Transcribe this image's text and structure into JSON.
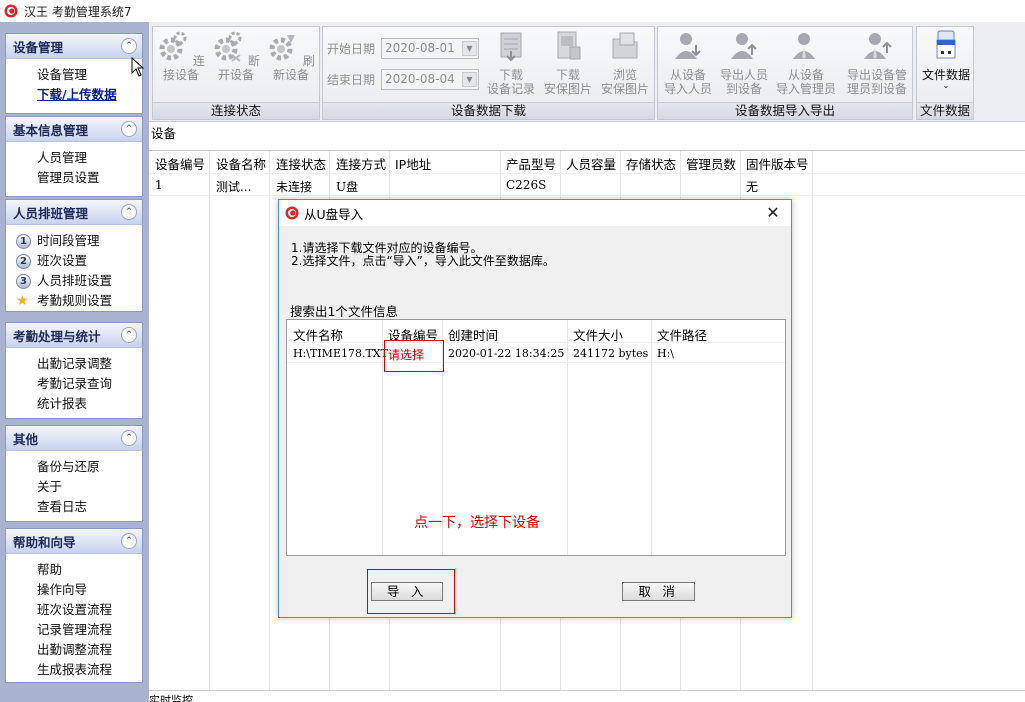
{
  "window": {
    "title": "汉王 考勤管理系统7"
  },
  "sidebar": {
    "panels": [
      {
        "title": "设备管理",
        "items": [
          "设备管理",
          "下载/上传数据"
        ]
      },
      {
        "title": "基本信息管理",
        "items": [
          "人员管理",
          "管理员设置"
        ]
      },
      {
        "title": "人员排班管理",
        "items": [
          "时间段管理",
          "班次设置",
          "人员排班设置",
          "考勤规则设置"
        ],
        "badges": [
          "1",
          "2",
          "3"
        ]
      },
      {
        "title": "考勤处理与统计",
        "items": [
          "出勤记录调整",
          "考勤记录查询",
          "统计报表"
        ]
      },
      {
        "title": "其他",
        "items": [
          "备份与还原",
          "关于",
          "查看日志"
        ]
      },
      {
        "title": "帮助和向导",
        "items": [
          "帮助",
          "操作向导",
          "班次设置流程",
          "记录管理流程",
          "出勤调整流程",
          "生成报表流程"
        ]
      }
    ]
  },
  "toolbar": {
    "connection": {
      "label": "连接状态",
      "connect": "连接设备",
      "disconnect": "断开设备",
      "refresh": "刷新设备"
    },
    "download": {
      "label": "设备数据下载",
      "start_label": "开始日期",
      "start_value": "2020-08-01",
      "end_label": "结束日期",
      "end_value": "2020-08-04",
      "btn1": [
        "下载",
        "设备记录"
      ],
      "btn2": [
        "下载",
        "安保图片"
      ],
      "btn3": [
        "浏览",
        "安保图片"
      ]
    },
    "io": {
      "label": "设备数据导入导出",
      "btn1": [
        "从设备",
        "导入人员"
      ],
      "btn2": [
        "导出人员",
        "到设备"
      ],
      "btn3": [
        "从设备",
        "导入管理员"
      ],
      "btn4": [
        "导出设备管",
        "理员到设备"
      ]
    },
    "file": {
      "label": "文件数据",
      "button": "文件数据"
    }
  },
  "main": {
    "title": "设备",
    "columns": [
      "设备编号",
      "设备名称",
      "连接状态",
      "连接方式",
      "IP地址",
      "产品型号",
      "人员容量",
      "存储状态",
      "管理员数",
      "固件版本号"
    ],
    "rows": [
      [
        "1",
        "测试...",
        "未连接",
        "U盘",
        "",
        "C226S",
        "",
        "",
        "",
        "无"
      ]
    ]
  },
  "statusbar": {
    "text": "实时监控"
  },
  "dialog": {
    "title": "从U盘导入",
    "instruction1": "1.请选择下载文件对应的设备编号。",
    "instruction2": "2.选择文件，点击“导入”，导入此文件至数据库。",
    "found": "搜索出1个文件信息",
    "columns": [
      "文件名称",
      "设备编号",
      "创建时间",
      "文件大小",
      "文件路径"
    ],
    "rows": [
      [
        "H:\\TIME178.TXT",
        "请选择",
        "2020-01-22 18:34:25",
        "241172 bytes",
        "H:\\"
      ]
    ],
    "hint": "点一下，选择下设备",
    "import_btn": "导 入",
    "cancel_btn": "取 消"
  },
  "colors": {
    "accent_red": "#d40000",
    "sidebar_bg": "#a9b2ce",
    "dialog_border": "#4a90d8"
  }
}
